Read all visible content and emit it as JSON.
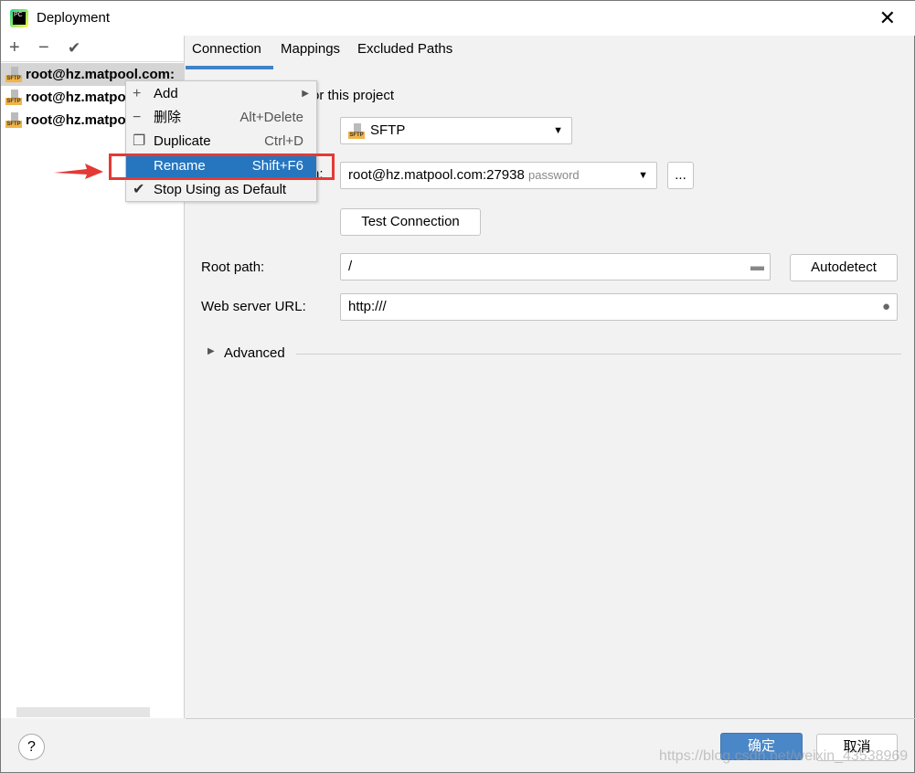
{
  "window": {
    "title": "Deployment",
    "icon": "pycharm-logo",
    "logo_text": "PC"
  },
  "toolbar": {
    "add": "+",
    "remove": "−",
    "check": "✔"
  },
  "servers": [
    {
      "name": "root@hz.matpool.com:",
      "icon": "sftp-icon"
    },
    {
      "name": "root@hz.matpool.com:",
      "icon": "sftp-icon"
    },
    {
      "name": "root@hz.matpool.com:",
      "icon": "sftp-icon"
    }
  ],
  "tabs": [
    {
      "label": "Connection",
      "active": true
    },
    {
      "label": "Mappings"
    },
    {
      "label": "Excluded Paths"
    }
  ],
  "form": {
    "partial_default": "or this project",
    "type_value": "SFTP",
    "type_icon_text": "SFTP",
    "ssh_label_partial": "n:",
    "ssh_value": "root@hz.matpool.com:27938",
    "ssh_hint": "password",
    "more": "...",
    "test": "Test Connection",
    "root_label": "Root path:",
    "root_value": "/",
    "autodetect": "Autodetect",
    "web_label": "Web server URL:",
    "web_value": "http:///",
    "advanced": "Advanced"
  },
  "context_menu": [
    {
      "label": "Add",
      "icon": "plus-icon",
      "shortcut": "",
      "submenu": true
    },
    {
      "label": "删除",
      "icon": "minus-icon",
      "shortcut": "Alt+Delete"
    },
    {
      "label": "Duplicate",
      "icon": "duplicate-icon",
      "shortcut": "Ctrl+D"
    },
    {
      "label": "Rename",
      "icon": "",
      "shortcut": "Shift+F6",
      "selected": true
    },
    {
      "label": "Stop Using as Default",
      "icon": "check-icon",
      "shortcut": ""
    }
  ],
  "footer": {
    "help": "?",
    "ok": "确定",
    "cancel": "取消",
    "watermark": "https://blog.csdn.net/weixin_43538969"
  },
  "colors": {
    "accent": "#2675bf",
    "ok_button": "#4a87c8",
    "annotation": "#e53935"
  }
}
